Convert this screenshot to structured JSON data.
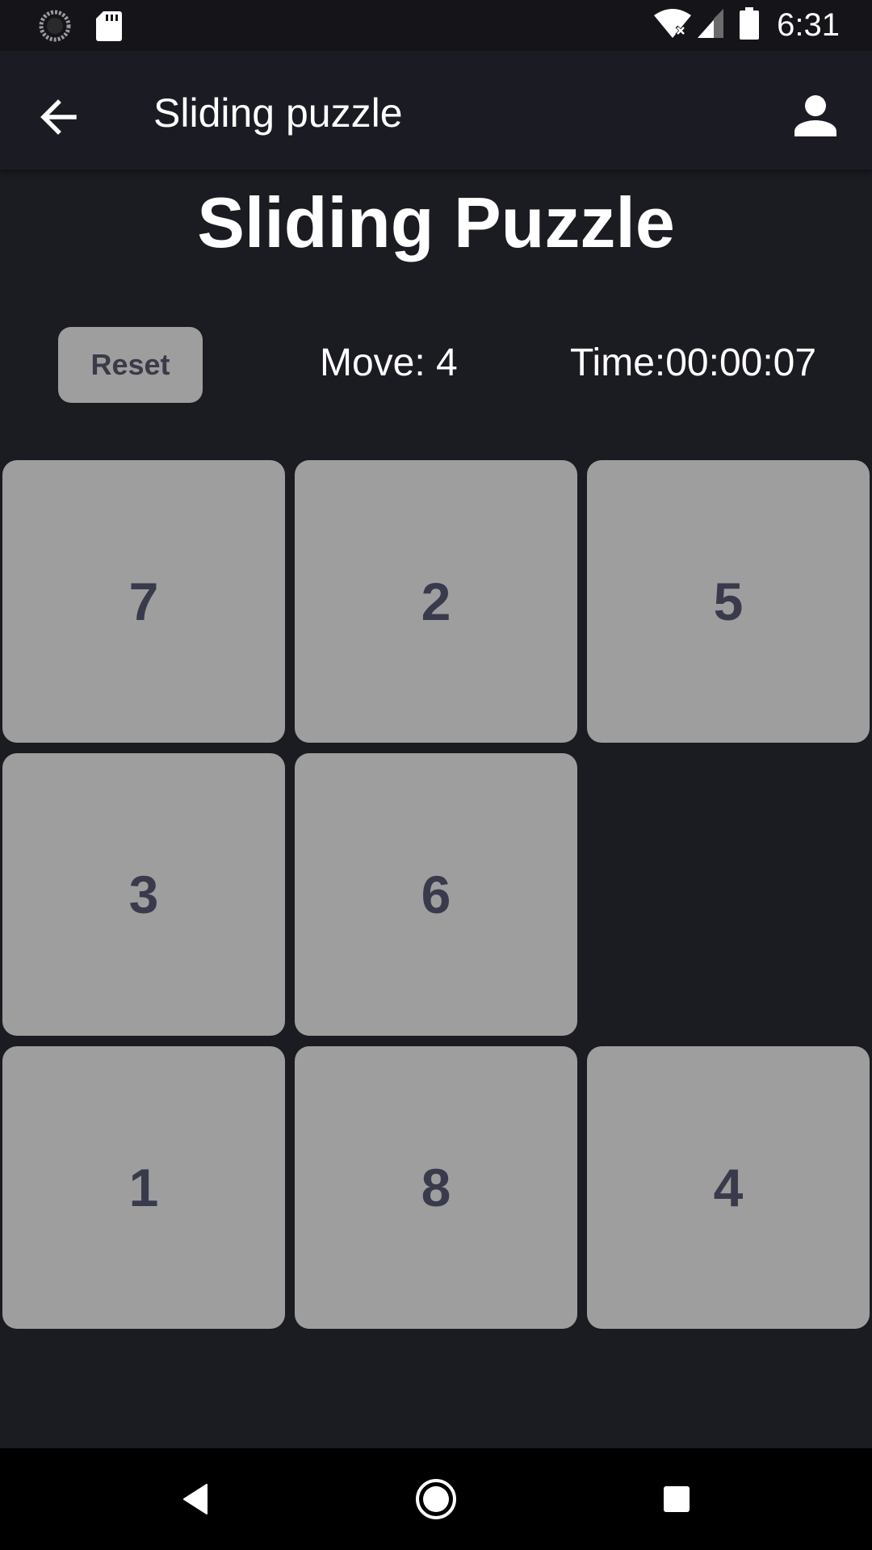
{
  "status_bar": {
    "time": "6:31",
    "icons": [
      "loading-icon",
      "sd-card-icon",
      "wifi-off-icon",
      "signal-icon",
      "battery-icon"
    ]
  },
  "app_bar": {
    "title": "Sliding puzzle",
    "back_icon": "arrow-back-icon",
    "profile_icon": "person-icon"
  },
  "game": {
    "heading": "Sliding Puzzle",
    "reset_label": "Reset",
    "moves_text": "Move: 4",
    "time_text": "Time:00:00:07",
    "grid": [
      [
        "7",
        "2",
        "5"
      ],
      [
        "3",
        "6",
        ""
      ],
      [
        "1",
        "8",
        "4"
      ]
    ]
  },
  "nav_bar": {
    "icons": [
      "back-triangle-icon",
      "home-circle-icon",
      "recents-square-icon"
    ]
  },
  "colors": {
    "background": "#1b1b22",
    "tile": "#9e9e9e",
    "tile_text": "#393a4c"
  }
}
